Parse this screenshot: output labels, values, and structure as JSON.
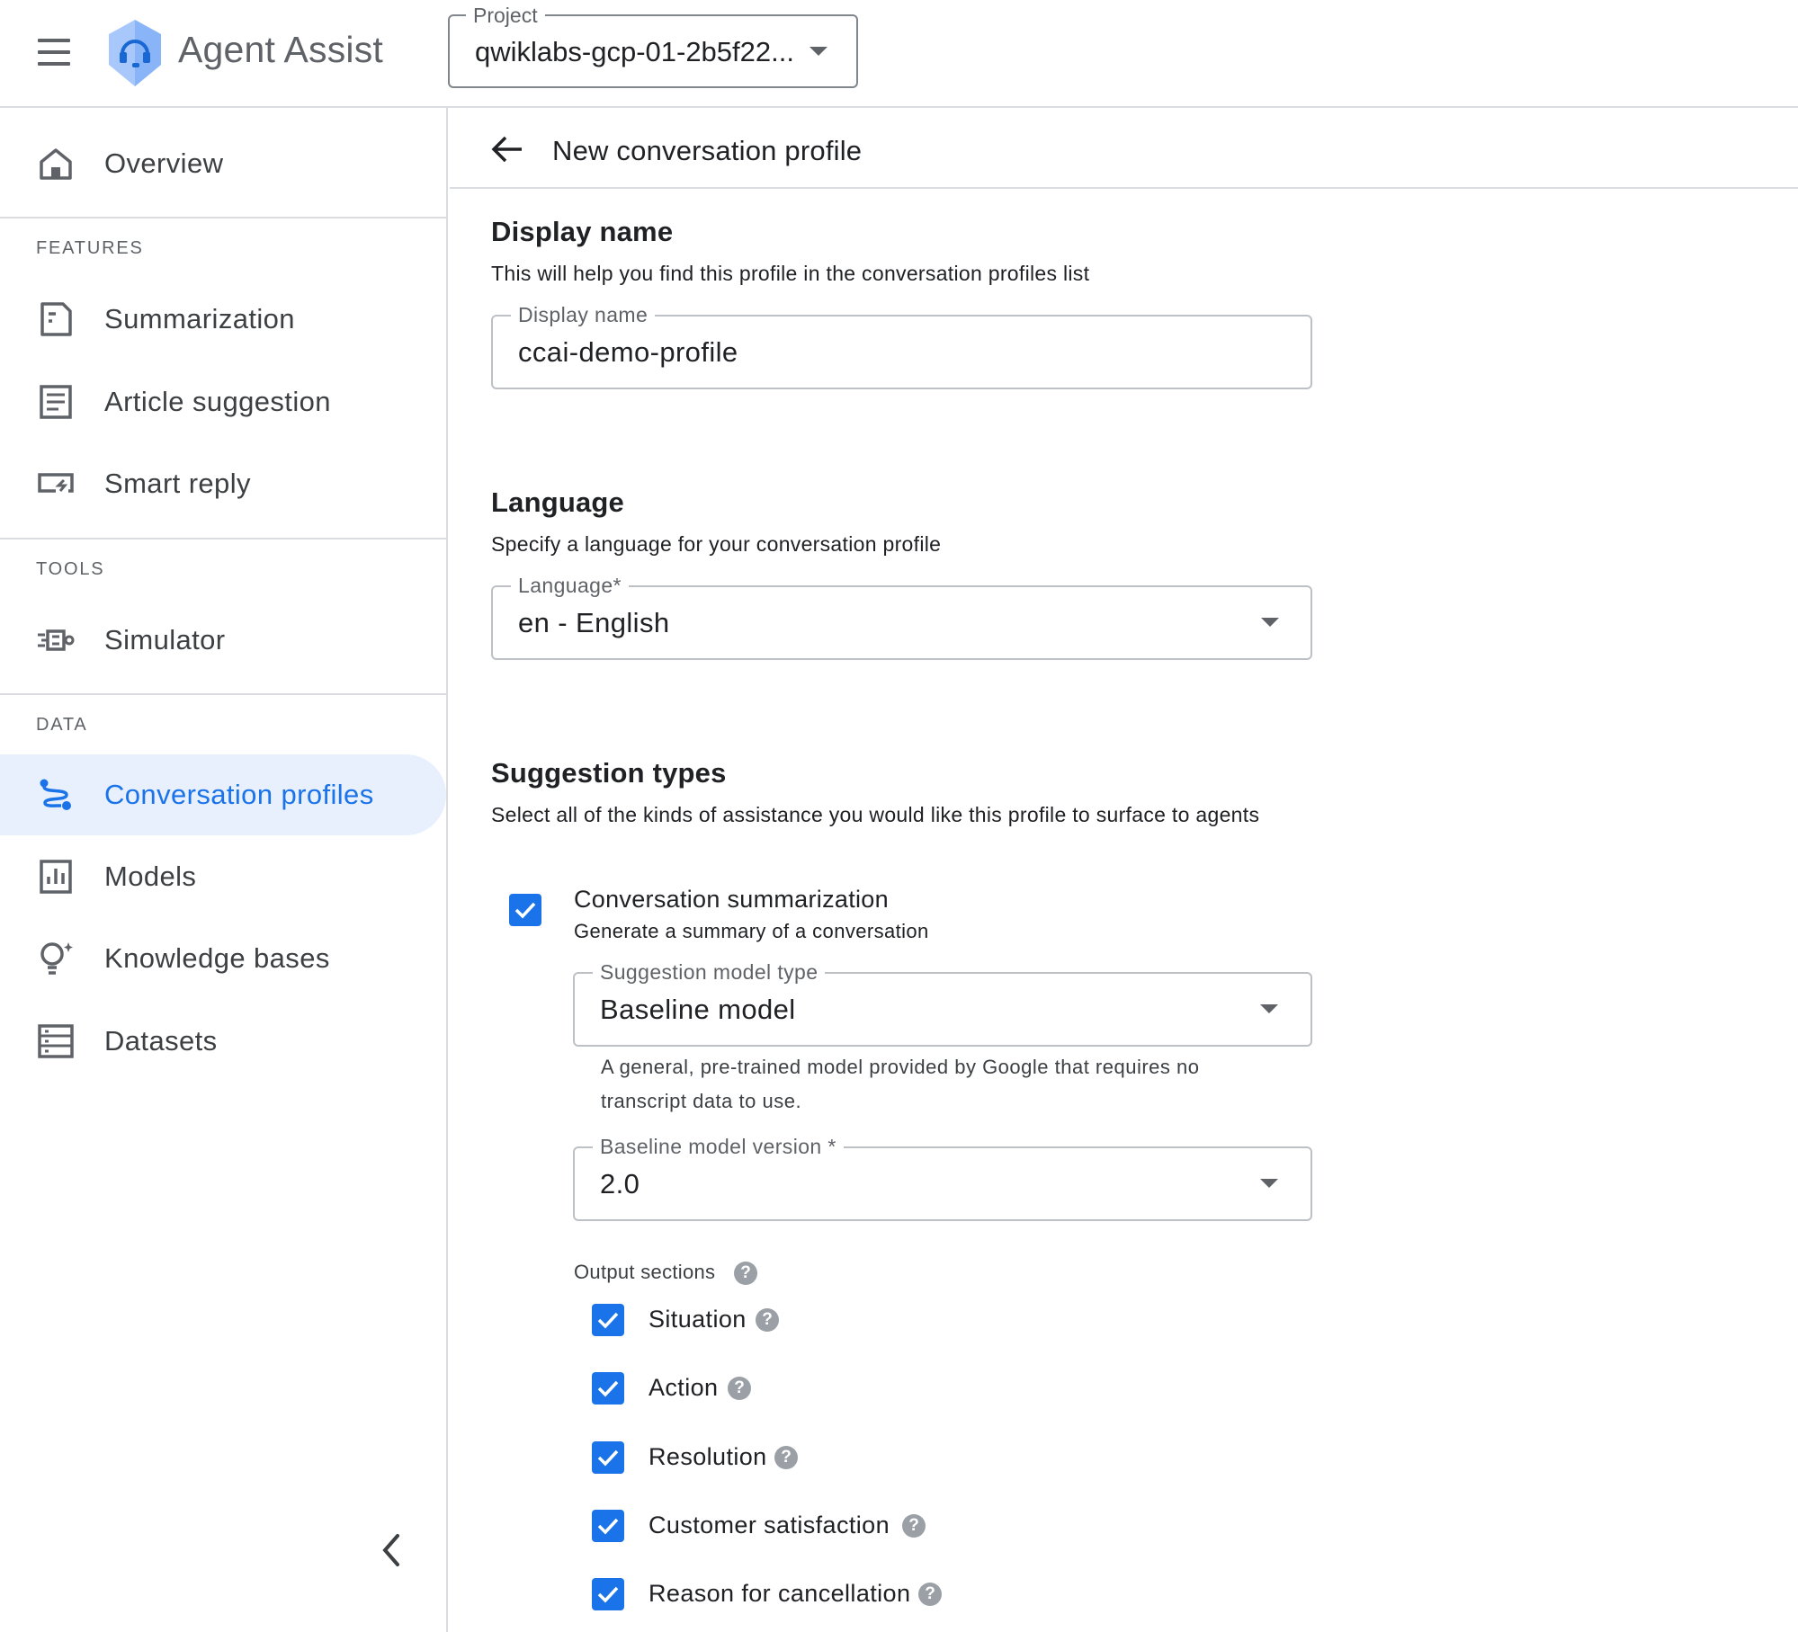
{
  "header": {
    "app_title": "Agent Assist",
    "project_label": "Project",
    "project_value": "qwiklabs-gcp-01-2b5f22..."
  },
  "sidebar": {
    "overview": "Overview",
    "features_label": "FEATURES",
    "features": [
      "Summarization",
      "Article suggestion",
      "Smart reply"
    ],
    "tools_label": "TOOLS",
    "tools": [
      "Simulator"
    ],
    "data_label": "DATA",
    "data": [
      "Conversation profiles",
      "Models",
      "Knowledge bases",
      "Datasets"
    ],
    "active_item": "Conversation profiles"
  },
  "page": {
    "title": "New conversation profile"
  },
  "display_name": {
    "heading": "Display name",
    "description": "This will help you find this profile in the conversation profiles list",
    "field_label": "Display name",
    "value": "ccai-demo-profile"
  },
  "language": {
    "heading": "Language",
    "description": "Specify a language for your conversation profile",
    "field_label": "Language*",
    "value": "en - English"
  },
  "suggestion_types": {
    "heading": "Suggestion types",
    "description": "Select all of the kinds of assistance you would like this profile to surface to agents",
    "summarization": {
      "checked": true,
      "title": "Conversation summarization",
      "subtitle": "Generate a summary of a conversation",
      "model_type_label": "Suggestion model type",
      "model_type_value": "Baseline model",
      "helper_line1": "A general, pre-trained model provided by Google that requires no",
      "helper_line2": "transcript data to use.",
      "version_label": "Baseline model version *",
      "version_value": "2.0",
      "output_sections_label": "Output sections",
      "output_sections": [
        {
          "label": "Situation",
          "checked": true
        },
        {
          "label": "Action",
          "checked": true
        },
        {
          "label": "Resolution",
          "checked": true
        },
        {
          "label": "Customer satisfaction",
          "checked": true
        },
        {
          "label": "Reason for cancellation",
          "checked": true
        }
      ]
    }
  },
  "colors": {
    "accent": "#1a73e8",
    "active_bg": "#e8f0fe",
    "text": "#202124",
    "muted": "#5f6368"
  },
  "icons": {
    "menu": "menu-icon",
    "logo": "agent-assist-logo-icon",
    "back": "arrow-back-icon",
    "help": "help-icon",
    "dropdown": "caret-down-icon"
  }
}
